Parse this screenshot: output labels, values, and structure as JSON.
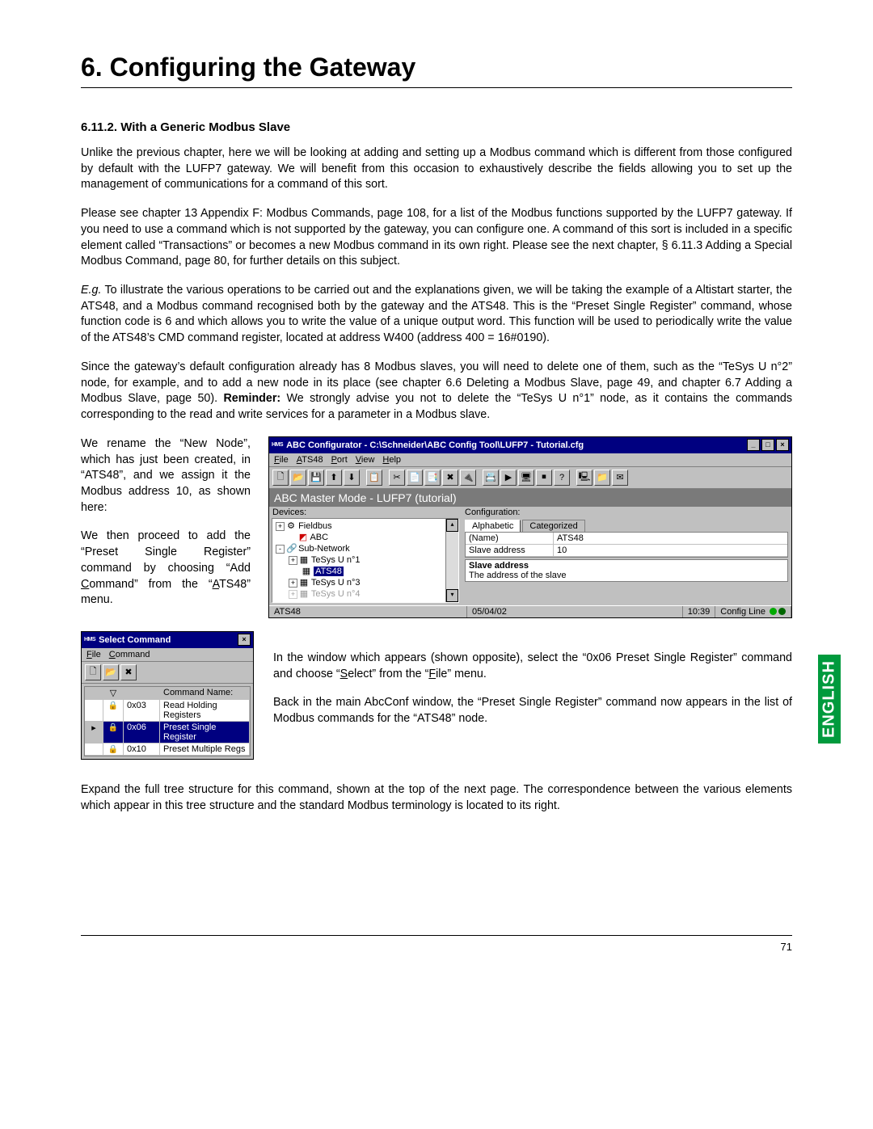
{
  "heading": "6. Configuring the Gateway",
  "subheading": "6.11.2. With a Generic Modbus Slave",
  "p1": "Unlike the previous chapter, here we will be looking at adding and setting up a Modbus command which is different from those configured by default with the LUFP7 gateway. We will benefit from this occasion to exhaustively describe the fields allowing you to set up the management of communications for a command of this sort.",
  "p2": "Please see chapter 13 Appendix F: Modbus Commands, page 108, for a list of the Modbus functions supported by the LUFP7 gateway. If you need to use a command which is not supported by the gateway, you can configure one. A command of this sort is included in a specific element called “Transactions” or becomes a new Modbus command in its own right. Please see the next chapter, § 6.11.3 Adding a Special Modbus Command, page 80, for further details on this subject.",
  "p3": " To illustrate the various operations to be carried out and the explanations given, we will be taking the example of a Altistart starter, the ATS48, and a Modbus command recognised both by the gateway and the ATS48. This is the “Preset Single Register” command, whose function code is 6 and which allows you to write the value of a unique output word. This function will be used to periodically write the value of the ATS48’s CMD command register, located at address W400 (address 400 = 16#0190).",
  "p3_lead": "E.g.",
  "p4a": "Since the gateway’s default configuration already has 8 Modbus slaves, you will need to delete one of them, such as the “TeSys U n°2” node, for example, and to add a new node in its place (see chapter 6.6 Deleting a Modbus Slave, page 49, and chapter 6.7 Adding a Modbus Slave, page 50). ",
  "p4_bold": "Reminder:",
  "p4b": " We strongly advise you not to delete the “TeSys U n°1” node, as it contains the commands corresponding to the read and write services for a parameter in a Modbus slave.",
  "p5": "We rename the “New Node”, which has just been created, in “ATS48”, and we assign it the Modbus address 10, as shown here:",
  "p6_a": "We then proceed to add the “Preset Single Register” command by choosing “Add ",
  "p6_cmd": "C",
  "p6_b": "ommand” from the “",
  "p6_ats": "A",
  "p6_c": "TS48” menu.",
  "p7_a": "In the window which appears (shown opposite), select the “0x06 Preset Single Register” command and choose “",
  "p7_s": "S",
  "p7_b": "elect” from the “",
  "p7_f": "F",
  "p7_c": "ile” menu.",
  "p8": "Back in the main AbcConf window, the “Preset Single Register” command now appears in the list of Modbus commands for the “ATS48” node.",
  "p9": "Expand the full tree structure for this command, shown at the top of the next page. The correspondence between the various elements which appear in this tree structure and the standard Modbus terminology is located to its right.",
  "page_number": "71",
  "lang_tab": "ENGLISH",
  "win1": {
    "hms": "HMS",
    "title": "ABC Configurator - C:\\Schneider\\ABC Config Tool\\LUFP7 - Tutorial.cfg",
    "menus": [
      "File",
      "ATS48",
      "Port",
      "View",
      "Help"
    ],
    "menus_u": [
      "F",
      "A",
      "P",
      "V",
      "H"
    ],
    "banner": "ABC Master Mode - LUFP7 (tutorial)",
    "devices_label": "Devices:",
    "config_label": "Configuration:",
    "tree": {
      "n0": "Fieldbus",
      "n1": "ABC",
      "n2": "Sub-Network",
      "n3": "TeSys U n°1",
      "n4": "ATS48",
      "n5": "TeSys U n°3",
      "n6": "TeSys U n°4"
    },
    "tabs": [
      "Alphabetic",
      "Categorized"
    ],
    "prop_name_k": "(Name)",
    "prop_name_v": "ATS48",
    "prop_addr_k": "Slave address",
    "prop_addr_v": "10",
    "desc_t": "Slave address",
    "desc_d": "The address of the slave",
    "status": {
      "left": "ATS48",
      "date": "05/04/02",
      "time": "10:39",
      "line": "Config Line"
    }
  },
  "win2": {
    "hms": "HMS",
    "title": "Select Command",
    "menus": [
      "File",
      "Command"
    ],
    "menus_u": [
      "F",
      "C"
    ],
    "hdr": "Command Name:",
    "rows": [
      {
        "code": "0x03",
        "name": "Read Holding Registers"
      },
      {
        "code": "0x06",
        "name": "Preset Single Register"
      },
      {
        "code": "0x10",
        "name": "Preset Multiple Regs"
      }
    ]
  }
}
